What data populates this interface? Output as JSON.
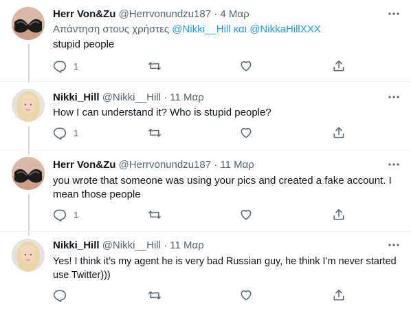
{
  "tweets": [
    {
      "name": "Herr Von&Zu",
      "handle": "@Herrvonundzu187",
      "dot": "·",
      "date": "4 Μαρ",
      "reply_prefix": "Απάντηση στους χρήστες",
      "reply_mention1": "@Nikki__Hill",
      "reply_conj": "και",
      "reply_mention2": "@NikkaHillXXX",
      "text": "stupid people",
      "reply_count": "1",
      "avatar": "bra-photo"
    },
    {
      "name": "Nikki_Hill",
      "handle": "@Nikki__Hill",
      "dot": "·",
      "date": "11 Μαρ",
      "text": "How I can understand it? Who is stupid people?",
      "reply_count": "1",
      "avatar": "blonde-woman-photo"
    },
    {
      "name": "Herr Von&Zu",
      "handle": "@Herrvonundzu187",
      "dot": "·",
      "date": "11 Μαρ",
      "text_line1": "you wrote that someone was using your pics and created a fake account. I",
      "text_line2": "mean those people",
      "reply_count": "1",
      "avatar": "bra-photo"
    },
    {
      "name": "Nikki_Hill",
      "handle": "@Nikki__Hill",
      "dot": "·",
      "date": "11 Μαρ",
      "text_line1": "Yes! I think it’s my agent he is very bad Russian guy, he think I’m never started",
      "text_line2": "use Twitter)))",
      "reply_count": "",
      "avatar": "blonde-woman-photo"
    }
  ],
  "colors": {
    "text": "#0f1419",
    "secondary": "#536471",
    "link": "#1d9bf0",
    "thread_line": "#cfd9de"
  },
  "icons": [
    "reply-icon",
    "retweet-icon",
    "like-icon",
    "share-icon",
    "more-icon"
  ]
}
